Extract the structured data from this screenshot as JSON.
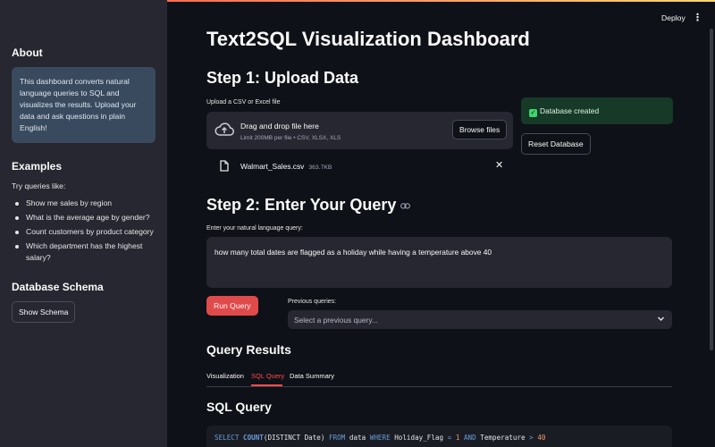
{
  "header": {
    "deploy_label": "Deploy",
    "menu_icon": "kebab-menu-icon"
  },
  "sidebar": {
    "about_heading": "About",
    "about_text": "This dashboard converts natural language queries to SQL and visualizes the results. Upload your data and ask questions in plain English!",
    "examples_heading": "Examples",
    "try_text": "Try queries like:",
    "examples": [
      "Show me sales by region",
      "What is the average age by gender?",
      "Count customers by product category",
      "Which department has the highest salary?"
    ],
    "schema_heading": "Database Schema",
    "show_schema_label": "Show Schema"
  },
  "main": {
    "title": "Text2SQL Visualization Dashboard",
    "step1_heading": "Step 1: Upload Data",
    "upload_label": "Upload a CSV or Excel file",
    "drag_text": "Drag and drop file here",
    "limit_text": "Limit 200MB per file • CSV, XLSX, XLS",
    "browse_label": "Browse files",
    "file_name": "Walmart_Sales.csv",
    "file_size": "363.7KB",
    "success_text": "Database created",
    "reset_label": "Reset Database",
    "step2_heading": "Step 2: Enter Your Query",
    "query_label": "Enter your natural language query:",
    "query_value": "how many total dates are flagged as a holiday while having a temperature above 40",
    "run_label": "Run Query",
    "previous_label": "Previous queries:",
    "previous_placeholder": "Select a previous query...",
    "results_heading": "Query Results",
    "tabs": [
      "Visualization",
      "SQL Query",
      "Data Summary"
    ],
    "active_tab": "SQL Query",
    "sql_heading": "SQL Query",
    "sql": {
      "t1": "SELECT",
      "t2": "COUNT",
      "t3": "(DISTINCT Date)",
      "t4": "FROM",
      "t5": "data",
      "t6": "WHERE",
      "t7": "Holiday_Flag",
      "t8": "=",
      "t9": "1",
      "t10": "AND",
      "t11": "Temperature",
      "t12": ">",
      "t13": "40"
    }
  },
  "colors": {
    "accent": "#ff4b4b",
    "success_bg": "#173928",
    "sidebar_bg": "#262730",
    "app_bg": "#0e1117"
  }
}
